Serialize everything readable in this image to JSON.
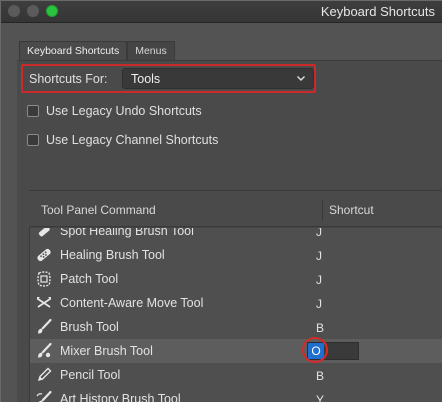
{
  "window": {
    "title": "Keyboard Shortcuts"
  },
  "tabs": [
    {
      "label": "Keyboard Shortcuts",
      "active": true
    },
    {
      "label": "Menus",
      "active": false
    }
  ],
  "shortcuts_for": {
    "label": "Shortcuts For:",
    "value": "Tools"
  },
  "options": {
    "legacy_undo": {
      "label": "Use Legacy Undo Shortcuts",
      "checked": false
    },
    "legacy_channel": {
      "label": "Use Legacy Channel Shortcuts",
      "checked": false
    }
  },
  "table": {
    "columns": [
      "Tool Panel Command",
      "Shortcut"
    ],
    "rows": [
      {
        "name": "Spot Healing Brush Tool",
        "key": "J",
        "icon": "spot-healing-brush-icon"
      },
      {
        "name": "Healing Brush Tool",
        "key": "J",
        "icon": "healing-brush-icon"
      },
      {
        "name": "Patch Tool",
        "key": "J",
        "icon": "patch-icon"
      },
      {
        "name": "Content-Aware Move Tool",
        "key": "J",
        "icon": "content-aware-move-icon"
      },
      {
        "name": "Brush Tool",
        "key": "B",
        "icon": "brush-icon"
      },
      {
        "name": "Mixer Brush Tool",
        "key": "O",
        "icon": "mixer-brush-icon",
        "selected": true,
        "editing": true
      },
      {
        "name": "Pencil Tool",
        "key": "B",
        "icon": "pencil-icon"
      },
      {
        "name": "Art History Brush Tool",
        "key": "Y",
        "icon": "art-history-brush-icon"
      }
    ]
  },
  "colors": {
    "highlight_red": "#d42a2a",
    "selection_blue": "#1f6fd1"
  }
}
